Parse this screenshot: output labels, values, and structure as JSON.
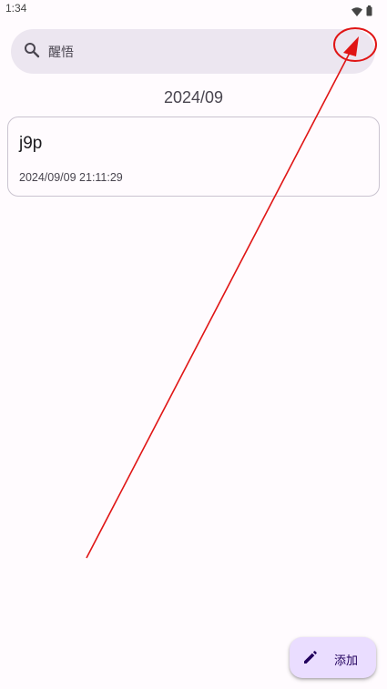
{
  "status_bar": {
    "time": "1:34",
    "icons": [
      "wifi-icon",
      "battery-icon"
    ]
  },
  "search": {
    "value": "醒悟",
    "icon": "search-icon"
  },
  "month_header": "2024/09",
  "notes": [
    {
      "title": "j9p",
      "date": "2024/09/09 21:11:29"
    }
  ],
  "fab": {
    "label": "添加",
    "icon": "pencil-icon"
  },
  "annotation": {
    "type": "red-arrow-with-circle",
    "color": "#e01515"
  },
  "colors": {
    "background": "#fffbfe",
    "search_bg": "#ece6f0",
    "card_border": "#cac4d0",
    "fab_bg": "#eaddff",
    "fab_text": "#21005d"
  }
}
